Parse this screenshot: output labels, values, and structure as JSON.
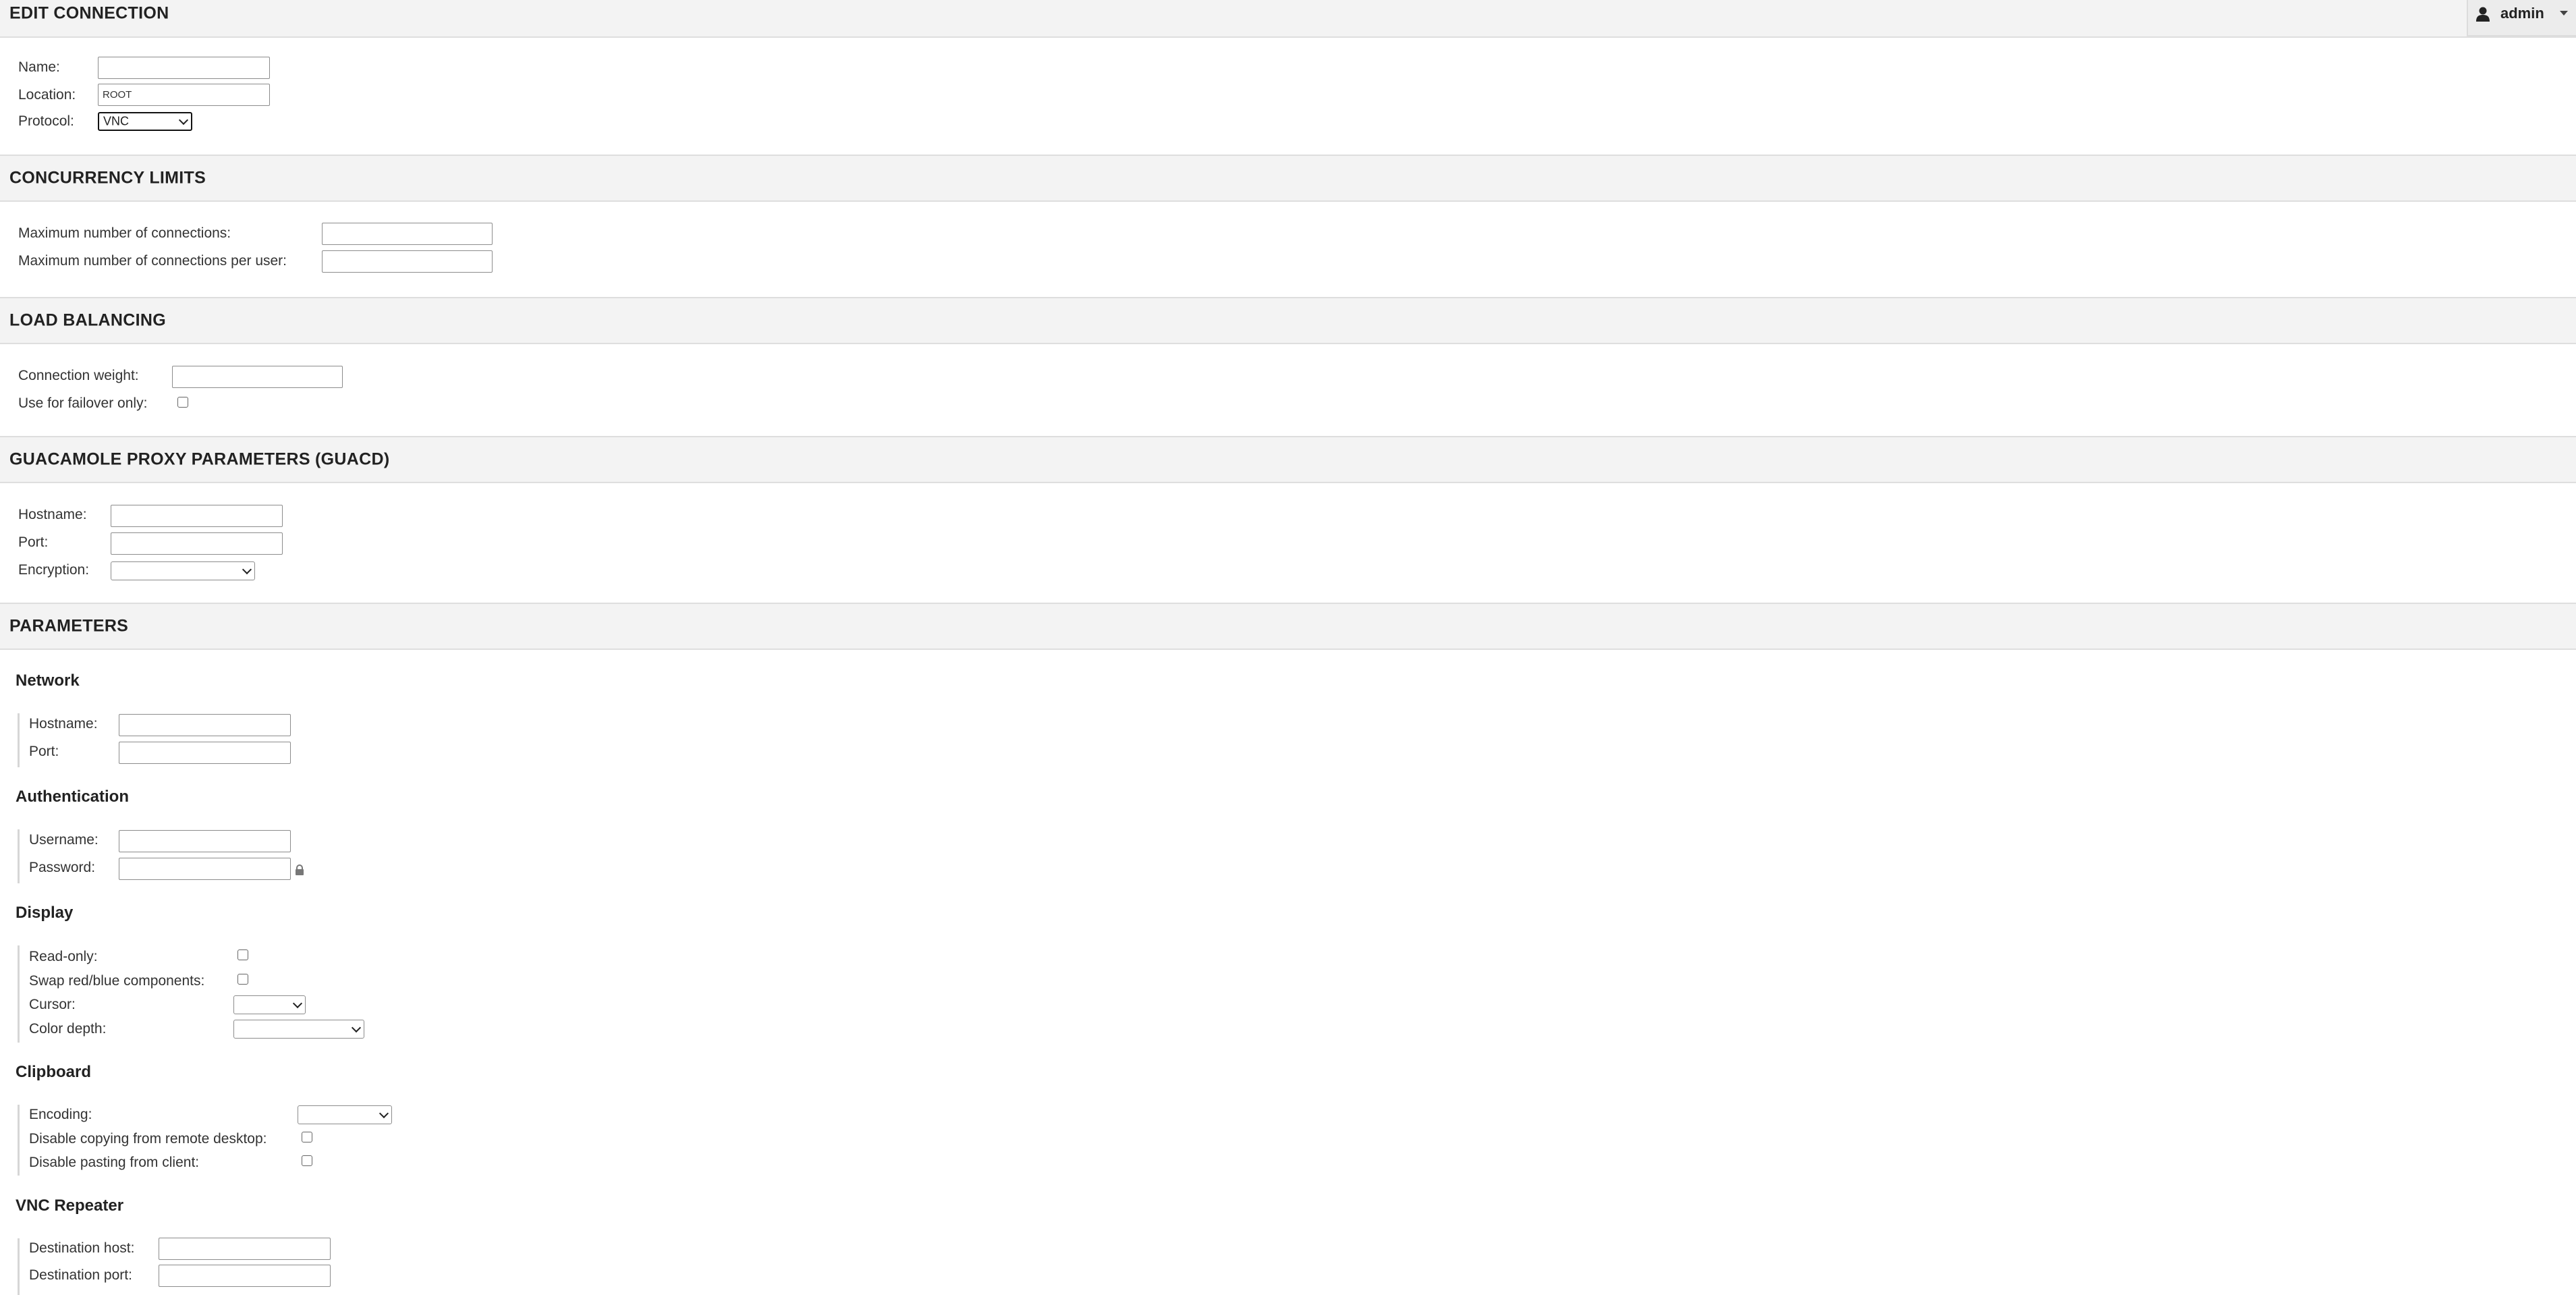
{
  "header": {
    "title": "EDIT CONNECTION",
    "user": {
      "name": "admin",
      "icon": "user-icon"
    }
  },
  "connection": {
    "name_label": "Name:",
    "name_value": "",
    "location_label": "Location:",
    "location_value": "ROOT",
    "protocol_label": "Protocol:",
    "protocol_value": "VNC"
  },
  "concurrency": {
    "title": "CONCURRENCY LIMITS",
    "max_connections_label": "Maximum number of connections:",
    "max_connections_per_user_label": "Maximum number of connections per user:"
  },
  "load_balancing": {
    "title": "LOAD BALANCING",
    "weight_label": "Connection weight:",
    "failover_label": "Use for failover only:"
  },
  "guacd": {
    "title": "GUACAMOLE PROXY PARAMETERS (GUACD)",
    "hostname_label": "Hostname:",
    "port_label": "Port:",
    "encryption_label": "Encryption:"
  },
  "parameters": {
    "title": "PARAMETERS",
    "network": {
      "title": "Network",
      "hostname_label": "Hostname:",
      "port_label": "Port:"
    },
    "authentication": {
      "title": "Authentication",
      "username_label": "Username:",
      "password_label": "Password:",
      "password_icon": "lock-icon"
    },
    "display": {
      "title": "Display",
      "readonly_label": "Read-only:",
      "swap_label": "Swap red/blue components:",
      "cursor_label": "Cursor:",
      "color_depth_label": "Color depth:"
    },
    "clipboard": {
      "title": "Clipboard",
      "encoding_label": "Encoding:",
      "disable_copy_label": "Disable copying from remote desktop:",
      "disable_paste_label": "Disable pasting from client:"
    },
    "repeater": {
      "title": "VNC Repeater",
      "dest_host_label": "Destination host:",
      "dest_port_label": "Destination port:"
    }
  }
}
